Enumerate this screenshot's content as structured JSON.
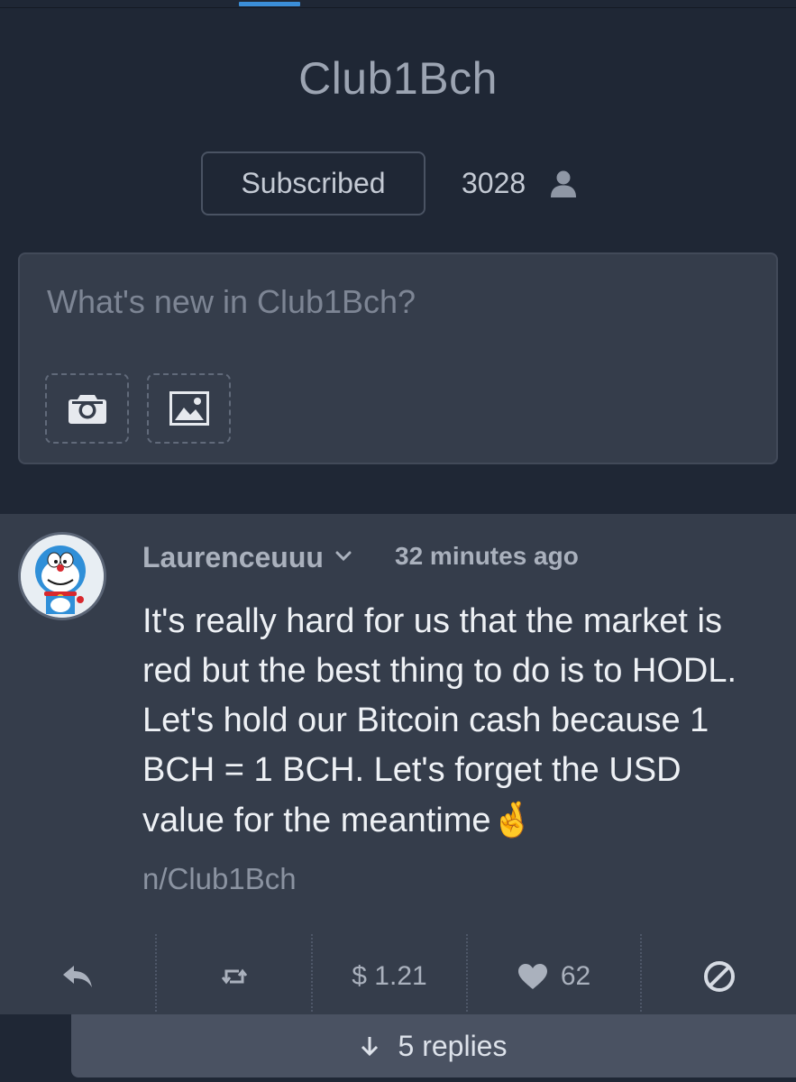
{
  "community": {
    "title": "Club1Bch",
    "subscribe_label": "Subscribed",
    "member_count": "3028",
    "member_icon": "user-icon"
  },
  "composer": {
    "placeholder": "What's new in Club1Bch?",
    "camera_icon": "camera-icon",
    "image_icon": "image-icon"
  },
  "post": {
    "author": "Laurenceuuu",
    "timestamp": "32 minutes ago",
    "body": "It's really hard for us that the market is red but the best thing to do is to HODL. Let's hold our Bitcoin cash because 1 BCH = 1 BCH. Let's forget the USD value for the meantime",
    "body_emoji": "🤞",
    "community_link": "n/Club1Bch",
    "actions": {
      "reply_icon": "reply-icon",
      "repost_icon": "repost-icon",
      "tip_amount": "$ 1.21",
      "like_count": "62",
      "block_icon": "block-icon"
    },
    "replies_label": "5 replies"
  },
  "colors": {
    "background": "#1f2735",
    "card": "#353d4b",
    "accent": "#3b8ed8"
  }
}
